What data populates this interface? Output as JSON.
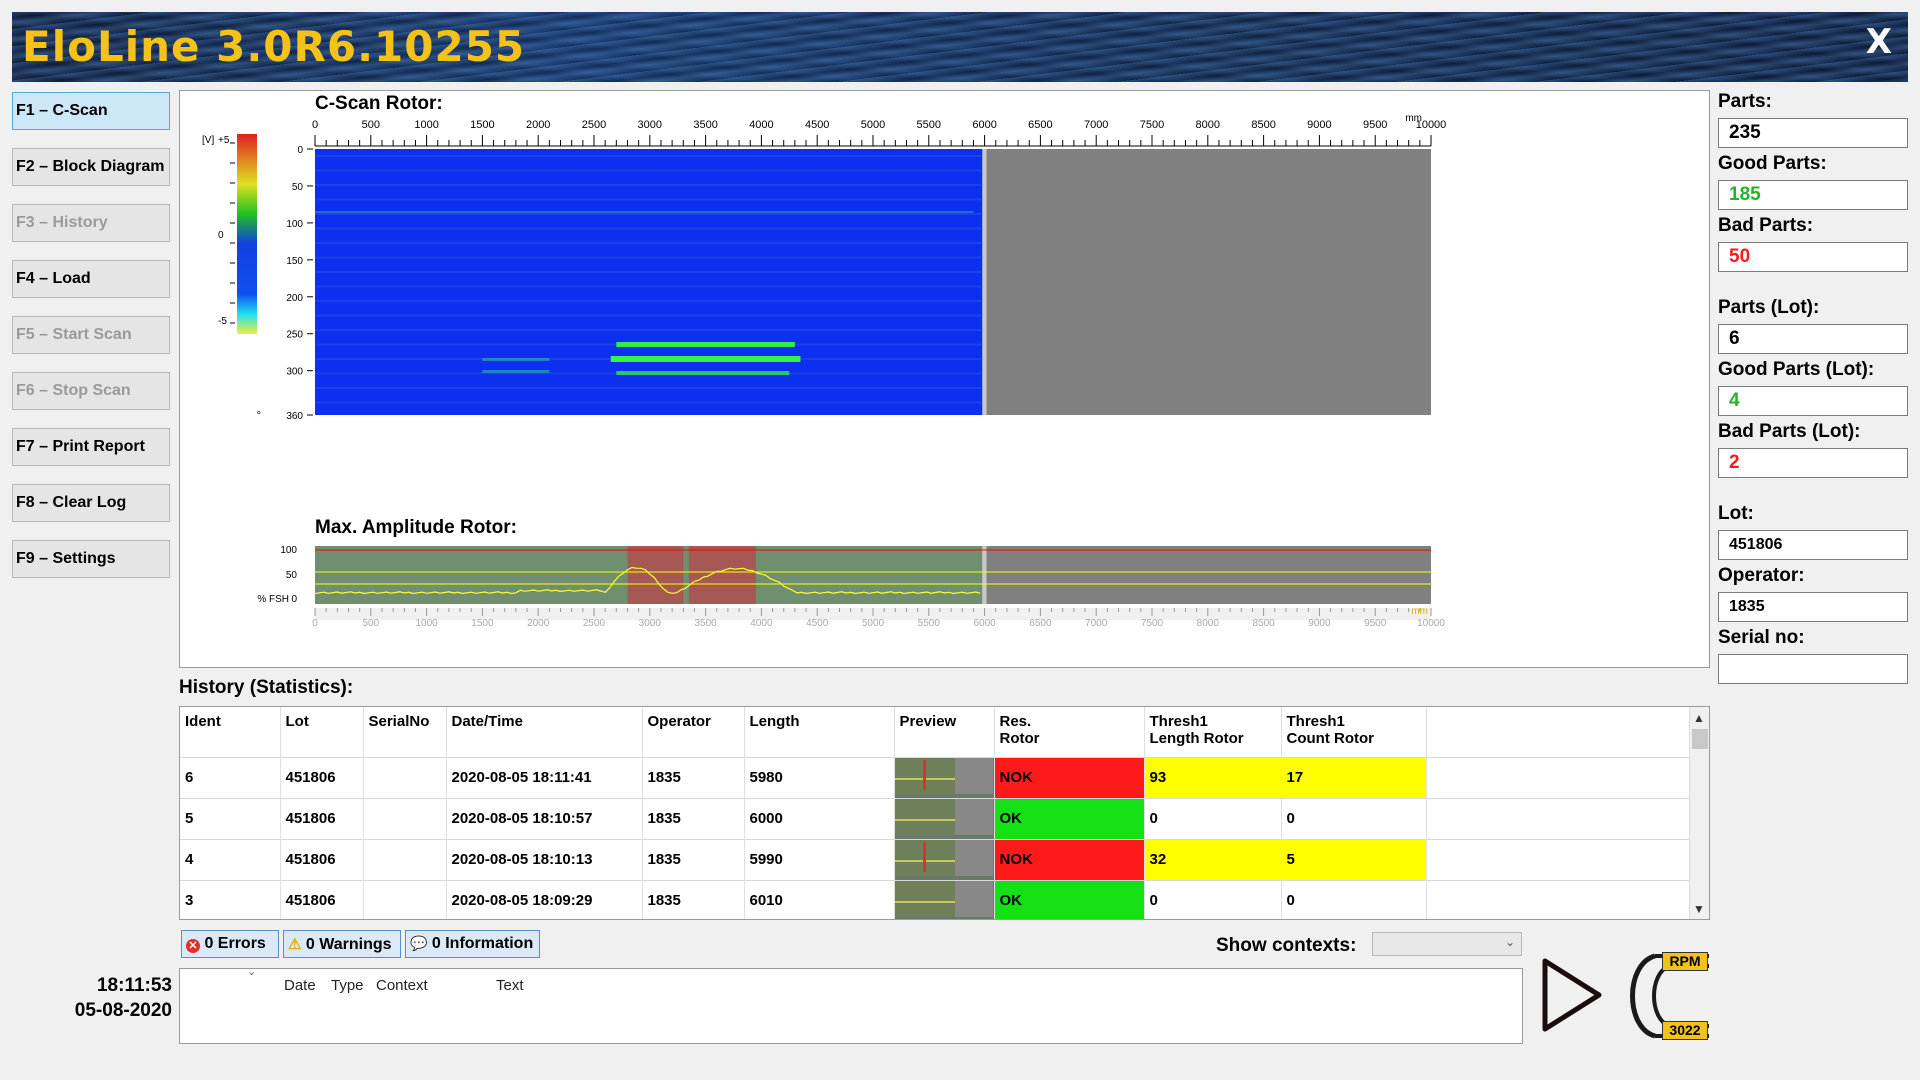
{
  "app": {
    "title": "EloLine 3.0R6.10255",
    "close_label": "X"
  },
  "buttons": [
    {
      "label": "F1 – C-Scan",
      "state": "active"
    },
    {
      "label": "F2 – Block Diagram",
      "state": "normal"
    },
    {
      "label": "F3 – History",
      "state": "disabled"
    },
    {
      "label": "F4 – Load",
      "state": "normal"
    },
    {
      "label": "F5 – Start Scan",
      "state": "disabled"
    },
    {
      "label": "F6 – Stop Scan",
      "state": "disabled"
    },
    {
      "label": "F7 – Print Report",
      "state": "normal"
    },
    {
      "label": "F8 – Clear Log",
      "state": "normal"
    },
    {
      "label": "F9 – Settings",
      "state": "normal"
    }
  ],
  "cscan": {
    "title": "C-Scan Rotor:",
    "x_unit": "mm",
    "x_ticks": [
      "0",
      "500",
      "1000",
      "1500",
      "2000",
      "2500",
      "3000",
      "3500",
      "4000",
      "4500",
      "5000",
      "5500",
      "6000",
      "6500",
      "7000",
      "7500",
      "8000",
      "8500",
      "9000",
      "9500",
      "10000"
    ],
    "y_ticks": [
      "0",
      "50",
      "100",
      "150",
      "200",
      "250",
      "300",
      "360"
    ],
    "y_deg_symbol": "°",
    "colorbar_unit": "[V]",
    "colorbar_ticks": [
      "+5",
      "0",
      "-5"
    ],
    "scanned_length": 5980,
    "max_length": 10000,
    "colors": {
      "background": "#0d2ff0",
      "unscanned": "#808080",
      "indication": "#39ff39"
    }
  },
  "amplitude": {
    "title": "Max. Amplitude Rotor:",
    "y_ticks": [
      "100",
      "50"
    ],
    "y_unit": "% FSH",
    "zero": "0",
    "threshold_lines_color": "#ffff00",
    "alarm_color": "#ff0000"
  },
  "stats": {
    "parts_label": "Parts:",
    "parts": "235",
    "good_label": "Good Parts:",
    "good": "185",
    "bad_label": "Bad Parts:",
    "bad": "50",
    "parts_lot_label": "Parts (Lot):",
    "parts_lot": "6",
    "good_lot_label": "Good Parts (Lot):",
    "good_lot": "4",
    "bad_lot_label": "Bad Parts (Lot):",
    "bad_lot": "2",
    "lot_label": "Lot:",
    "lot": "451806",
    "operator_label": "Operator:",
    "operator": "1835",
    "serial_label": "Serial no:",
    "serial": "",
    "good_color": "#22b422",
    "bad_color": "#ff1a1a"
  },
  "history": {
    "title": "History (Statistics):",
    "columns": [
      "Ident",
      "Lot",
      "SerialNo",
      "Date/Time",
      "Operator",
      "Length",
      "Preview",
      "Res.\nRotor",
      "Thresh1\nLength Rotor",
      "Thresh1\nCount Rotor"
    ],
    "rows": [
      {
        "ident": "6",
        "lot": "451806",
        "serial": "",
        "datetime": "2020-08-05 18:11:41",
        "operator": "1835",
        "length": "5980",
        "result": "NOK",
        "thr_len": "93",
        "thr_cnt": "17"
      },
      {
        "ident": "5",
        "lot": "451806",
        "serial": "",
        "datetime": "2020-08-05 18:10:57",
        "operator": "1835",
        "length": "6000",
        "result": "OK",
        "thr_len": "0",
        "thr_cnt": "0"
      },
      {
        "ident": "4",
        "lot": "451806",
        "serial": "",
        "datetime": "2020-08-05 18:10:13",
        "operator": "1835",
        "length": "5990",
        "result": "NOK",
        "thr_len": "32",
        "thr_cnt": "5"
      },
      {
        "ident": "3",
        "lot": "451806",
        "serial": "",
        "datetime": "2020-08-05 18:09:29",
        "operator": "1835",
        "length": "6010",
        "result": "OK",
        "thr_len": "0",
        "thr_cnt": "0"
      }
    ]
  },
  "log": {
    "errors": "0 Errors",
    "warnings": "0 Warnings",
    "information": "0 Information",
    "show_contexts_label": "Show contexts:",
    "show_contexts_value": "",
    "columns": [
      "Date",
      "Type",
      "Context",
      "Text"
    ]
  },
  "clock": {
    "time": "18:11:53",
    "date": "05-08-2020"
  },
  "rpm": {
    "label": "RPM",
    "value": "3022"
  }
}
